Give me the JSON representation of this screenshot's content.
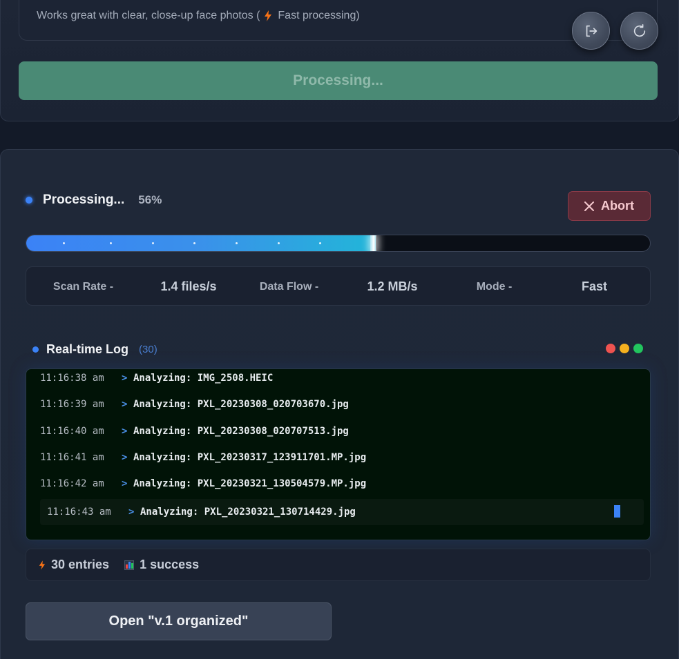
{
  "hint": {
    "text_before": "Works great with clear, close-up face photos (",
    "text_after": "Fast processing)",
    "icon": "lightning-bolt-icon"
  },
  "floating_buttons": [
    {
      "name": "logout-button",
      "icon": "logout-icon"
    },
    {
      "name": "refresh-button",
      "icon": "refresh-icon"
    }
  ],
  "primary_button": {
    "label": "Processing..."
  },
  "status": {
    "title": "Processing...",
    "percent_label": "56%",
    "progress": 0.56,
    "abort_label": "Abort"
  },
  "stats": {
    "scan_rate_label": "Scan Rate -",
    "scan_rate_value": "1.4 files/s",
    "data_flow_label": "Data Flow -",
    "data_flow_value": "1.2 MB/s",
    "mode_label": "Mode -",
    "mode_value": "Fast"
  },
  "log": {
    "title": "Real-time Log",
    "count": "(30)",
    "window_controls": [
      "#ef5350",
      "#f5b11f",
      "#22c55e"
    ],
    "lines": [
      {
        "time": "11:16:38 am",
        "arrow": ">",
        "message": "Analyzing: IMG_2508.HEIC"
      },
      {
        "time": "11:16:39 am",
        "arrow": ">",
        "message": "Analyzing: PXL_20230308_020703670.jpg"
      },
      {
        "time": "11:16:40 am",
        "arrow": ">",
        "message": "Analyzing: PXL_20230308_020707513.jpg"
      },
      {
        "time": "11:16:41 am",
        "arrow": ">",
        "message": "Analyzing: PXL_20230317_123911701.MP.jpg"
      },
      {
        "time": "11:16:42 am",
        "arrow": ">",
        "message": "Analyzing: PXL_20230321_130504579.MP.jpg"
      }
    ],
    "current": {
      "time": "11:16:43 am",
      "arrow": ">",
      "message": "Analyzing: PXL_20230321_130714429.jpg"
    }
  },
  "summary": {
    "entries_label": "30 entries",
    "success_label": "1 success",
    "entries_icon": "lightning-bolt-icon",
    "success_icon": "bar-chart-icon"
  },
  "open_button": {
    "label": "Open \"v.1 organized\""
  },
  "colors": {
    "accent": "#3b82f6",
    "processing_button": "#4a8a75",
    "abort_bg": "#5a2a36",
    "log_bg": "#011307"
  }
}
